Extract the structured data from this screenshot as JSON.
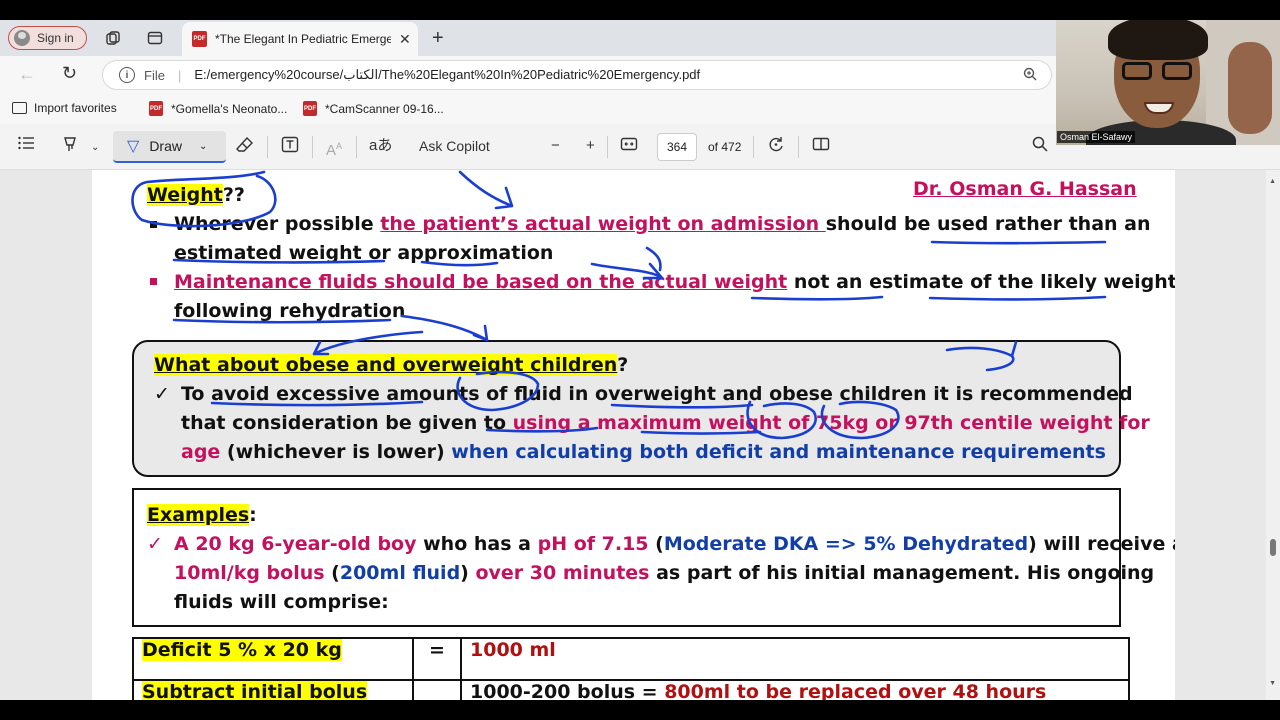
{
  "browser": {
    "sign_in_label": "Sign in",
    "tab_title": "*The Elegant In Pediatric Emergency.pdf",
    "tab_close": "✕",
    "new_tab": "+",
    "url_scheme": "File",
    "url": "E:/emergency%20course/الكتاب/The%20Elegant%20In%20Pediatric%20Emergency.pdf",
    "favorites": [
      {
        "label": "Import favorites"
      },
      {
        "label": "*Gomella's Neonato..."
      },
      {
        "label": "*CamScanner 09-16..."
      }
    ]
  },
  "pdf_toolbar": {
    "draw_label": "Draw",
    "ask_copilot_label": "Ask Copilot",
    "read_aloud_glyph": "aあ",
    "minus": "−",
    "plus": "+",
    "current_page": "364",
    "total_pages_label": "of 472"
  },
  "document": {
    "heading_weight": "Weight",
    "heading_weight_suffix": "??",
    "author": "Dr. Osman G. Hassan",
    "bullet1_pre": "Wherever possible ",
    "bullet1_pink": "the patient’s actual weight on admission ",
    "bullet1_post": "should be used rather than an",
    "bullet1_line2": "estimated weight or approximation",
    "bullet2_pink": "Maintenance fluids should be based on the actual weight",
    "bullet2_post": " not an estimate of the likely weight",
    "bullet2_line2": "following rehydration",
    "box1_heading": "What about obese and overweight children",
    "box1_heading_suffix": "?",
    "box1_check": "✓",
    "box1_line1": "To avoid excessive amounts of fluid in overweight and obese children it is recommended",
    "box1_line2_pre": "that consideration be given to ",
    "box1_line2_pink": "using a maximum weight of 75kg or 97th centile weight for",
    "box1_line3_pink": "age",
    "box1_line3_mid": " (whichever is lower) ",
    "box1_line3_blue": "when calculating both deficit and maintenance requirements",
    "examples_heading": "Examples",
    "examples_colon": ":",
    "ex_check": "✓",
    "ex_p1": "A 20 kg 6-year-old boy",
    "ex_p2": " who has a ",
    "ex_p3": "pH of 7.15",
    "ex_p4": " (",
    "ex_p5": "Moderate DKA => 5% Dehydrated",
    "ex_p6": ") will receive a",
    "ex_l2_p1": "10ml/kg bolus",
    "ex_l2_p2": " (",
    "ex_l2_p3": "200ml fluid",
    "ex_l2_p4": ") ",
    "ex_l2_p5": "over 30 minutes",
    "ex_l2_p6": " as part of his initial management. His ongoing",
    "ex_l3": "fluids will comprise:",
    "table": [
      {
        "label": "Deficit 5 % x 20 kg",
        "op": "=",
        "value_pre": "",
        "value_red": "1000 ml"
      },
      {
        "label": "Subtract initial bolus",
        "op": "",
        "value_pre": "1000-200 bolus = ",
        "value_red": "800ml to be replaced over 48 hours"
      }
    ]
  },
  "webcam": {
    "name": "Osman El-Safawy"
  },
  "colors": {
    "pink_text": "#c4115e",
    "blue_text": "#123ea8",
    "highlight": "#ffff00",
    "ink": "#1a3fd0",
    "table_red": "#b01010"
  }
}
